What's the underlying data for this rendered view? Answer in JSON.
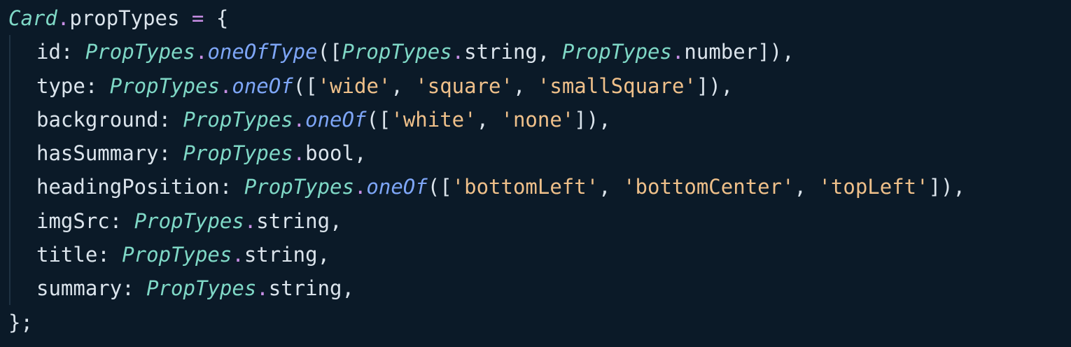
{
  "code": {
    "l1": {
      "obj": "Card",
      "dot": ".",
      "prop": "propTypes",
      "eq": " = ",
      "brace": "{"
    },
    "l2": {
      "key": "id: ",
      "pt1": "PropTypes",
      "dot1": ".",
      "fn": "oneOfType",
      "open": "([",
      "pt2": "PropTypes",
      "dot2": ".",
      "t2": "string",
      "sep": ", ",
      "pt3": "PropTypes",
      "dot3": ".",
      "t3": "number",
      "close": "]),"
    },
    "l3": {
      "key": "type: ",
      "pt": "PropTypes",
      "dot": ".",
      "fn": "oneOf",
      "open": "([",
      "s1": "'wide'",
      "c1": ", ",
      "s2": "'square'",
      "c2": ", ",
      "s3": "'smallSquare'",
      "close": "]),"
    },
    "l4": {
      "key": "background: ",
      "pt": "PropTypes",
      "dot": ".",
      "fn": "oneOf",
      "open": "([",
      "s1": "'white'",
      "c1": ", ",
      "s2": "'none'",
      "close": "]),"
    },
    "l5": {
      "key": "hasSummary: ",
      "pt": "PropTypes",
      "dot": ".",
      "t": "bool",
      "end": ","
    },
    "l6": {
      "key": "headingPosition: ",
      "pt": "PropTypes",
      "dot": ".",
      "fn": "oneOf",
      "open": "([",
      "s1": "'bottomLeft'",
      "c1": ", ",
      "s2": "'bottomCenter'",
      "c2": ", ",
      "s3": "'topLeft'",
      "close": "]),"
    },
    "l7": {
      "key": "imgSrc: ",
      "pt": "PropTypes",
      "dot": ".",
      "t": "string",
      "end": ","
    },
    "l8": {
      "key": "title: ",
      "pt": "PropTypes",
      "dot": ".",
      "t": "string",
      "end": ","
    },
    "l9": {
      "key": "summary: ",
      "pt": "PropTypes",
      "dot": ".",
      "t": "string",
      "end": ","
    },
    "l10": {
      "close": "};"
    }
  },
  "colors": {
    "background": "#0b1a28",
    "class_name": "#7fd8c6",
    "function": "#7ea6f7",
    "operator": "#c98fe6",
    "string": "#efc08a",
    "plain": "#dbe4ec"
  }
}
